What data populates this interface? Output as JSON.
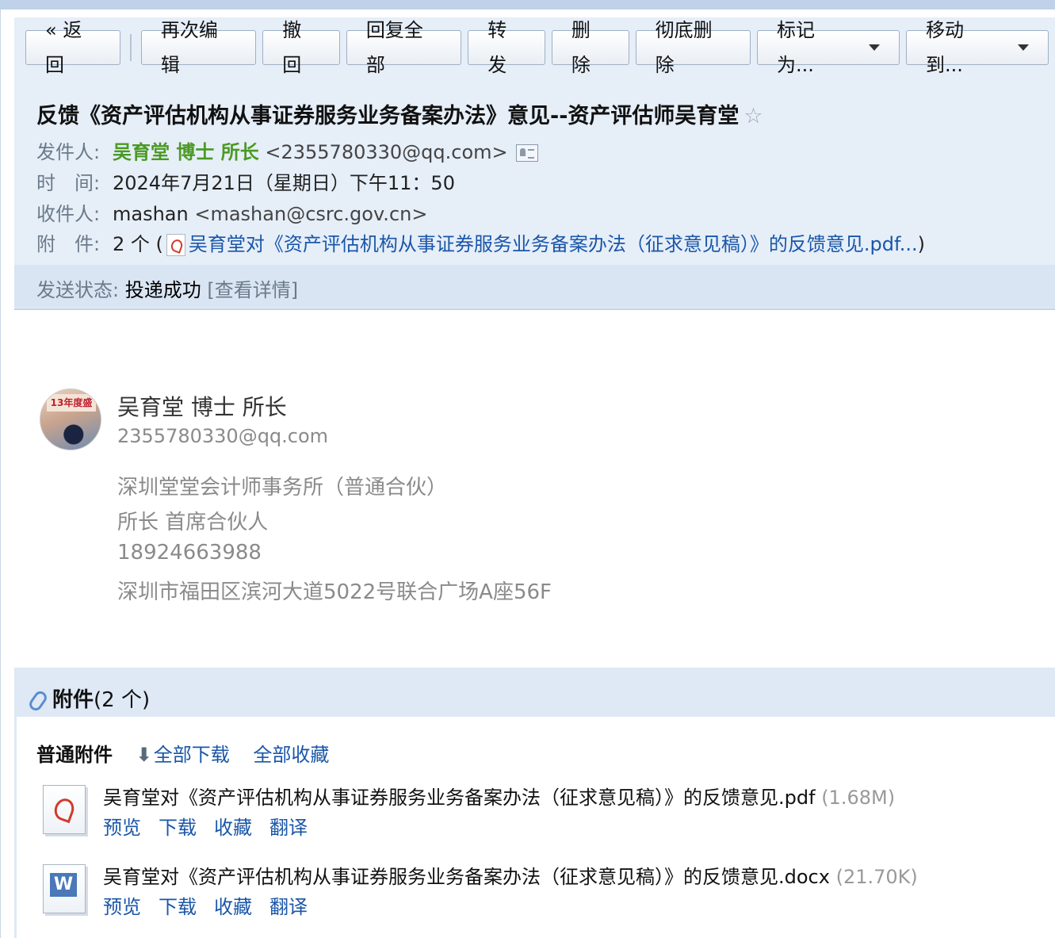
{
  "toolbar": {
    "back": "« 返回",
    "reedit": "再次编辑",
    "recall": "撤回",
    "reply_all": "回复全部",
    "forward": "转发",
    "delete": "删除",
    "perm_delete": "彻底删除",
    "mark_as": "标记为...",
    "move_to": "移动到..."
  },
  "email": {
    "subject": "反馈《资产评估机构从事证券服务业务备案办法》意见--资产评估师吴育堂",
    "star": "☆",
    "from_label": "发件人:",
    "from_name": "吴育堂 博士 所长",
    "from_addr": "<2355780330@qq.com>",
    "time_label": "时　间:",
    "time": "2024年7月21日（星期日）下午11：50",
    "to_label": "收件人:",
    "to_name": "mashan",
    "to_addr": "<mashan@csrc.gov.cn>",
    "att_label": "附　件:",
    "att_count": "2 个 (",
    "att_first": "吴育堂对《资产评估机构从事证券服务业务备案办法（征求意见稿）》的反馈意见.pdf...",
    "att_close": ")",
    "status_label": "发送状态:",
    "status": "投递成功",
    "status_detail": "[查看详情]"
  },
  "signature": {
    "avatar_text": "13年度盛",
    "name": "吴育堂 博士 所长",
    "email": "2355780330@qq.com",
    "company": "深圳堂堂会计师事务所（普通合伙）",
    "title": "所长 首席合伙人",
    "phone": "18924663988",
    "address": "深圳市福田区滨河大道5022号联合广场A座56F"
  },
  "attachments": {
    "title": "附件",
    "count": "(2 个)",
    "normal_label": "普通附件",
    "download_all": "全部下载",
    "collect_all": "全部收藏",
    "files": [
      {
        "name": "吴育堂对《资产评估机构从事证券服务业务备案办法（征求意见稿）》的反馈意见.pdf",
        "size": "(1.68M)",
        "icon": "pdf-file-icon"
      },
      {
        "name": "吴育堂对《资产评估机构从事证券服务业务备案办法（征求意见稿）》的反馈意见.docx",
        "size": "(21.70K)",
        "icon": "word-file-icon"
      }
    ],
    "actions": {
      "preview": "预览",
      "download": "下载",
      "collect": "收藏",
      "translate": "翻译"
    }
  }
}
